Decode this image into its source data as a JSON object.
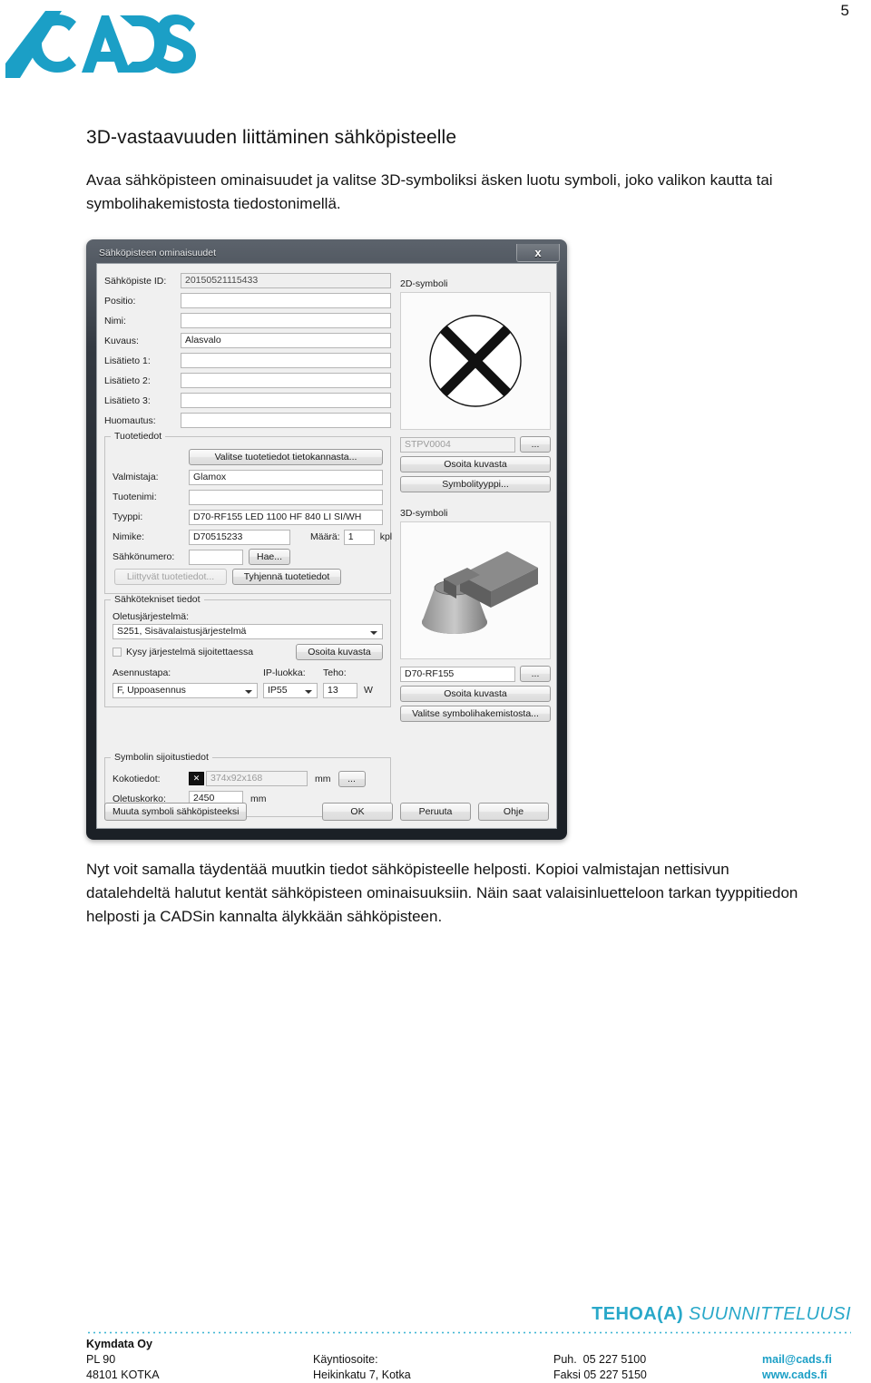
{
  "page": {
    "number": "5"
  },
  "brand": {
    "logo_text": "CADS",
    "logo_color": "#1b9fc6"
  },
  "article": {
    "title": "3D-vastaavuuden liittäminen sähköpisteelle",
    "intro": "Avaa sähköpisteen ominaisuudet ja valitse 3D-symboliksi äsken luotu symboli, joko valikon kautta tai symbolihakemistosta tiedostonimellä.",
    "outro": "Nyt voit samalla täydentää muutkin tiedot sähköpisteelle helposti. Kopioi valmistajan nettisivun datalehdeltä halutut kentät sähköpisteen ominaisuuksiin. Näin saat valaisinluetteloon tarkan tyyppitiedon helposti ja CADSin kannalta älykkään sähköpisteen."
  },
  "dialog": {
    "title": "Sähköpisteen ominaisuudet",
    "close_label": "x",
    "fields": [
      {
        "label": "Sähköpiste ID:",
        "value": "20150521115433",
        "readonly": true
      },
      {
        "label": "Positio:",
        "value": "",
        "readonly": false
      },
      {
        "label": "Nimi:",
        "value": "",
        "readonly": false
      },
      {
        "label": "Kuvaus:",
        "value": "Alasvalo",
        "readonly": false
      },
      {
        "label": "Lisätieto 1:",
        "value": "",
        "readonly": false
      },
      {
        "label": "Lisätieto 2:",
        "value": "",
        "readonly": false
      },
      {
        "label": "Lisätieto 3:",
        "value": "",
        "readonly": false
      },
      {
        "label": "Huomautus:",
        "value": "",
        "readonly": false
      }
    ],
    "product_group": {
      "title": "Tuotetiedot",
      "select_db_button": "Valitse tuotetiedot tietokannasta...",
      "manufacturer_label": "Valmistaja:",
      "manufacturer_value": "Glamox",
      "productname_label": "Tuotenimi:",
      "productname_value": "",
      "type_label": "Tyyppi:",
      "type_value": "D70-RF155 LED 1100 HF 840 LI SI/WH",
      "item_label": "Nimike:",
      "item_value": "D70515233",
      "qty_label": "Määrä:",
      "qty_value": "1",
      "qty_unit": "kpl",
      "enumber_label": "Sähkönumero:",
      "enumber_value": "",
      "search_button": "Hae...",
      "related_button": "Liittyvät tuotetiedot...",
      "clear_button": "Tyhjennä tuotetiedot"
    },
    "electrical_group": {
      "title": "Sähkötekniset tiedot",
      "system_label": "Oletusjärjestelmä:",
      "system_value": "S251, Sisävalaistusjärjestelmä",
      "ask_checkbox_label": "Kysy järjestelmä sijoitettaessa",
      "pick_button": "Osoita kuvasta",
      "mount_label": "Asennustapa:",
      "mount_value": "F, Uppoasennus",
      "ip_label": "IP-luokka:",
      "ip_value": "IP55",
      "power_label": "Teho:",
      "power_value": "13",
      "power_unit": "W"
    },
    "placement_group": {
      "title": "Symbolin sijoitustiedot",
      "size_label": "Kokotiedot:",
      "size_value": "374x92x168",
      "size_unit": "mm",
      "size_browse_button": "...",
      "size_toggle_icon": "block-arrow-icon",
      "height_label": "Oletuskorko:",
      "height_value": "2450",
      "height_unit": "mm"
    },
    "symbol2d": {
      "title": "2D-symboli",
      "preview_icon": "crossed-circle-symbol",
      "name_value": "STPV0004",
      "browse_button": "...",
      "pick_button": "Osoita kuvasta",
      "type_button": "Symbolityyppi..."
    },
    "symbol3d": {
      "title": "3D-symboli",
      "preview_icon": "downlight-3d-model",
      "name_value": "D70-RF155",
      "browse_button": "...",
      "pick_button": "Osoita kuvasta",
      "library_button": "Valitse symbolihakemistosta..."
    },
    "footer": {
      "convert_button": "Muuta symboli sähköpisteeksi",
      "ok_button": "OK",
      "cancel_button": "Peruuta",
      "help_button": "Ohje"
    }
  },
  "pagefooter": {
    "slogan_bold": "TEHOA(A)",
    "slogan_italic": "SUUNNITTELUUSI",
    "company": "Kymdata Oy",
    "pobox": "PL 90",
    "postal": "48101 KOTKA",
    "visit_label": "Käyntiosoite:",
    "visit_value": "Heikinkatu 7, Kotka",
    "phone_label": "Puh.",
    "phone_value": "05 227 5100",
    "fax_label": "Faksi",
    "fax_value": "05 227 5150",
    "email": "mail@cads.fi",
    "web": "www.cads.fi"
  }
}
